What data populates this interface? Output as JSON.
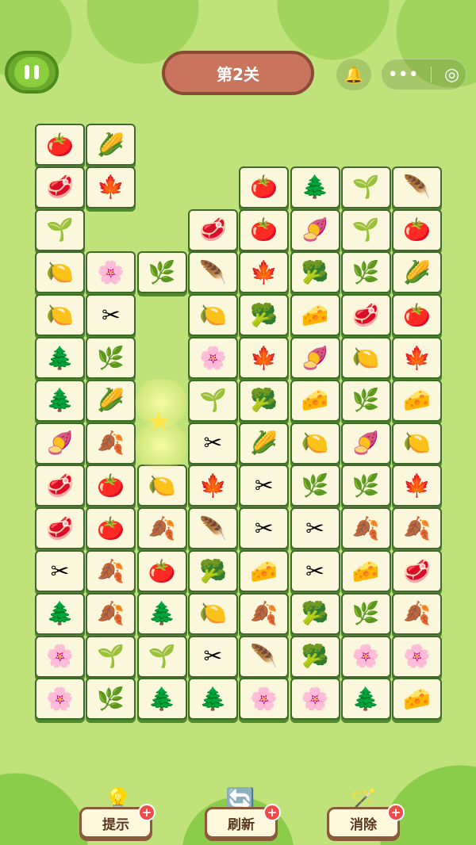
{
  "header": {
    "level_title": "第2关",
    "bell_icon": "bell-icon",
    "menu_icon": "•••",
    "record_icon": "◎"
  },
  "tile_icons": {
    "tomato": "🍅",
    "corn": "🌽",
    "meat": "🥩",
    "red_leaf": "🍁",
    "seed_bag": "🌱",
    "pink_leaf": "🪶",
    "tree": "🌲",
    "beet": "🍠",
    "lemon": "🍋",
    "flower": "🌸",
    "herb": "🌿",
    "cauliflower": "🥦",
    "scissors": "✂",
    "cheese": "🧀",
    "maple": "🍂"
  },
  "board_rows": [
    [
      "tomato",
      "corn",
      null,
      null,
      null,
      null,
      null,
      null
    ],
    [
      "meat",
      "red_leaf",
      null,
      null,
      "tomato",
      "tree",
      "seed_bag",
      "pink_leaf"
    ],
    [
      "seed_bag",
      null,
      null,
      "meat",
      "tomato",
      "beet",
      "seed_bag",
      "tomato"
    ],
    [
      "lemon",
      "flower",
      "herb",
      "pink_leaf",
      "red_leaf",
      "cauliflower",
      "herb",
      "corn"
    ],
    [
      "lemon",
      "scissors",
      null,
      "lemon",
      "cauliflower",
      "cheese",
      "meat",
      "tomato"
    ],
    [
      "tree",
      "herb",
      null,
      "flower",
      "red_leaf",
      "beet",
      "lemon",
      "red_leaf"
    ],
    [
      "tree",
      "corn",
      null,
      "seed_bag",
      "cauliflower",
      "cheese",
      "herb",
      "cheese"
    ],
    [
      "beet",
      "maple",
      null,
      "scissors",
      "corn",
      "lemon",
      "beet",
      "lemon"
    ],
    [
      "meat",
      "tomato",
      "lemon",
      "red_leaf",
      "scissors",
      "herb",
      "herb",
      "red_leaf"
    ],
    [
      "meat",
      "tomato",
      "maple",
      "pink_leaf",
      "scissors",
      "scissors",
      "maple",
      "maple"
    ],
    [
      "scissors",
      "maple",
      "tomato",
      "cauliflower",
      "cheese",
      "scissors",
      "cheese",
      "meat"
    ],
    [
      "tree",
      "maple",
      "tree",
      "lemon",
      "maple",
      "cauliflower",
      "herb",
      "maple"
    ],
    [
      "flower",
      "seed_bag",
      "seed_bag",
      "scissors",
      "pink_leaf",
      "cauliflower",
      "flower",
      "flower"
    ],
    [
      "flower",
      "herb",
      "tree",
      "tree",
      "flower",
      "flower",
      "tree",
      "cheese"
    ]
  ],
  "tools": {
    "hint": {
      "label": "提示",
      "icon": "💡"
    },
    "refresh": {
      "label": "刷新",
      "icon": "🔄"
    },
    "remove": {
      "label": "消除",
      "icon": "🪄"
    },
    "plus": "+"
  }
}
